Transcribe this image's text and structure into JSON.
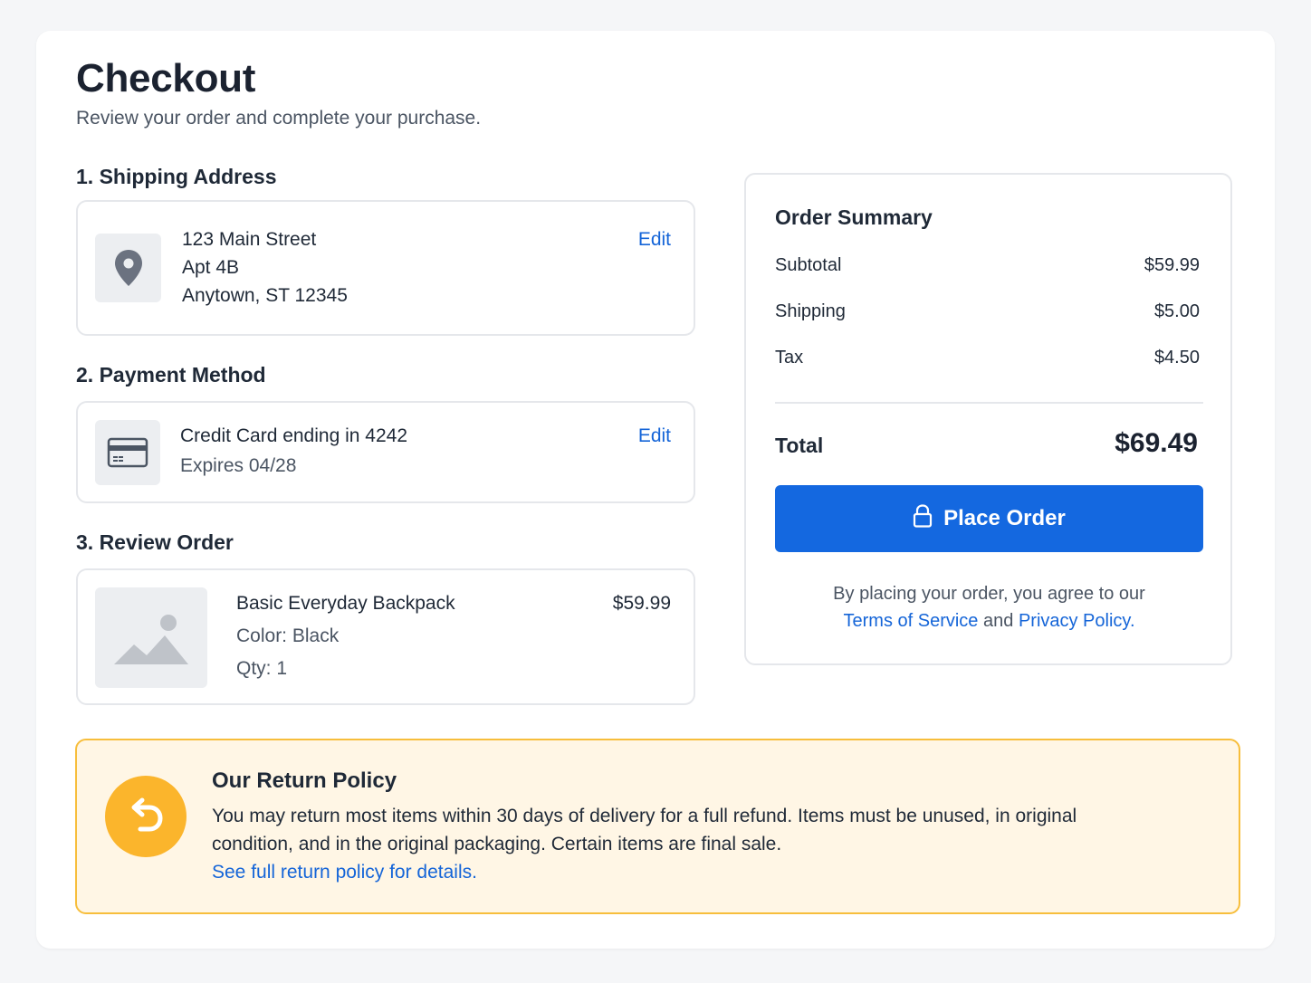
{
  "header": {
    "title": "Checkout",
    "subtitle": "Review your order and complete your purchase."
  },
  "shipping": {
    "heading": "1. Shipping Address",
    "line1": "123 Main Street",
    "line2": "Apt 4B",
    "line3": "Anytown, ST 12345",
    "edit_label": "Edit",
    "icon": "map-pin-icon"
  },
  "payment": {
    "heading": "2. Payment Method",
    "card_text": "Credit Card ending in 4242",
    "expires": "Expires 04/28",
    "edit_label": "Edit",
    "icon": "credit-card-icon"
  },
  "review": {
    "heading": "3. Review Order",
    "item": {
      "name": "Basic Everyday Backpack",
      "color": "Color: Black",
      "qty": "Qty: 1",
      "price": "$59.99",
      "icon": "image-placeholder-icon"
    }
  },
  "summary": {
    "heading": "Order Summary",
    "rows": [
      {
        "label": "Subtotal",
        "value": "$59.99"
      },
      {
        "label": "Shipping",
        "value": "$5.00"
      },
      {
        "label": "Tax",
        "value": "$4.50"
      }
    ],
    "total_label": "Total",
    "total_value": "$69.49",
    "place_order_label": "Place Order",
    "agree_prefix": "By placing your order, you agree to our",
    "terms_link": "Terms of Service",
    "and_text": "and",
    "privacy_link": "Privacy Policy",
    "period": "."
  },
  "return_policy": {
    "heading": "Our Return Policy",
    "text": "You may return most items within 30 days of delivery for a full refund. Items must be unused, in original condition, and in the original packaging. Certain items are final sale.",
    "link": "See full return policy for details.",
    "icon": "return-arrow-icon"
  },
  "colors": {
    "accent": "#1468e0",
    "link": "#1565d8",
    "policy_bg": "#fff6e5",
    "policy_border": "#f7be3c",
    "policy_icon": "#fbb52c"
  }
}
